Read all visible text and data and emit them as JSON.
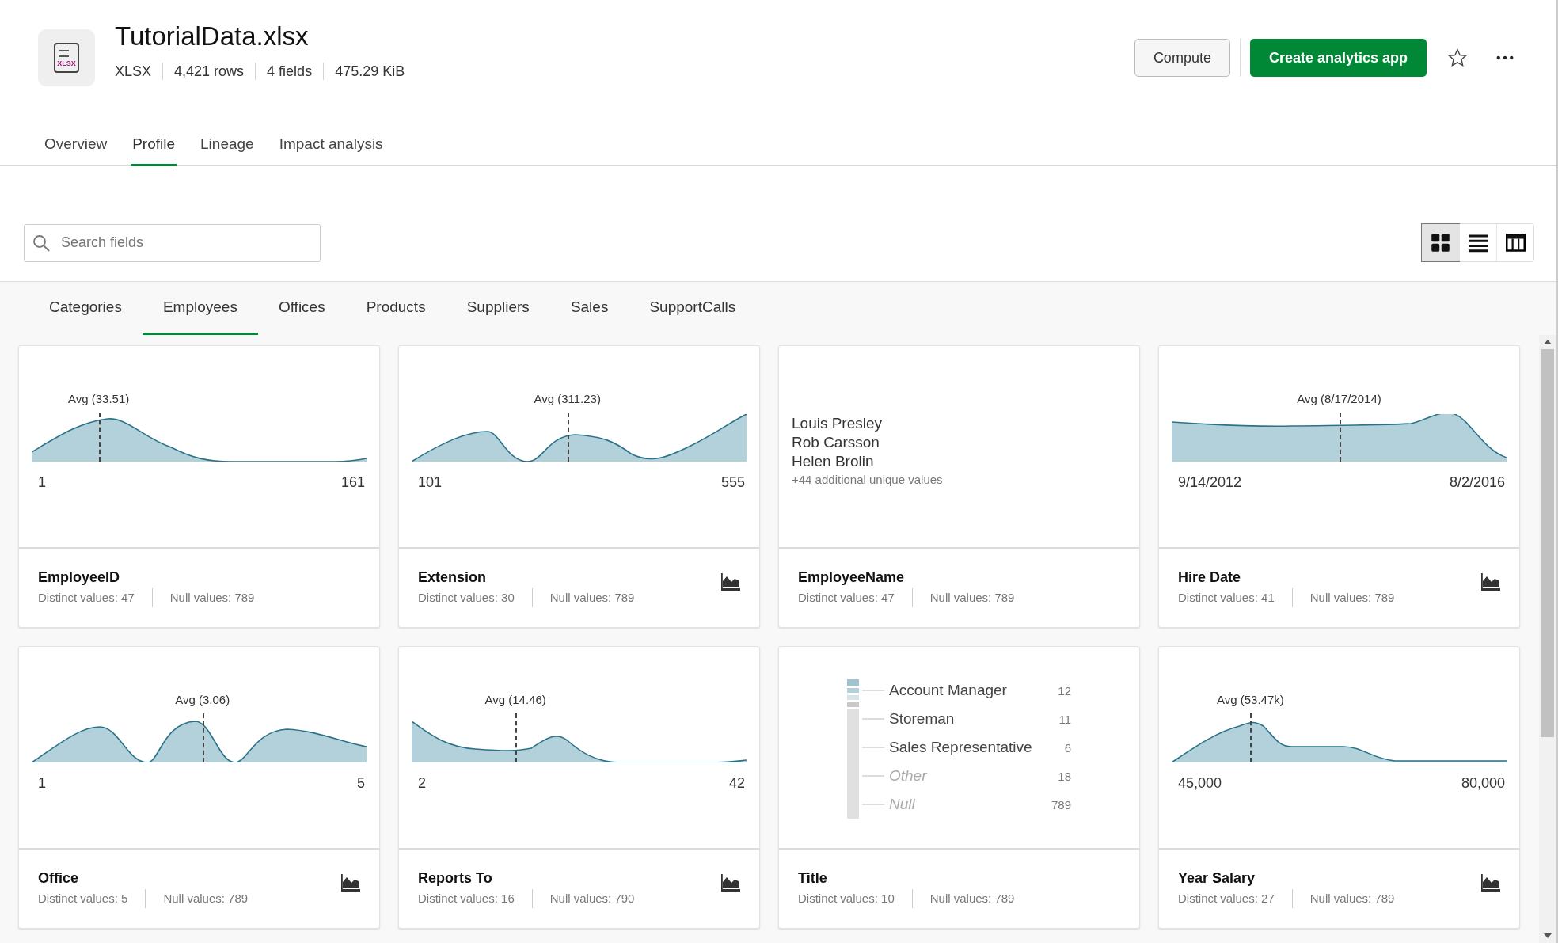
{
  "header": {
    "file_badge": "XLSX",
    "title": "TutorialData.xlsx",
    "meta": [
      "XLSX",
      "4,421 rows",
      "4 fields",
      "475.29 KiB"
    ],
    "buttons": {
      "compute": "Compute",
      "create": "Create analytics app"
    }
  },
  "tabs": [
    {
      "label": "Overview",
      "selected": false
    },
    {
      "label": "Profile",
      "selected": true
    },
    {
      "label": "Lineage",
      "selected": false
    },
    {
      "label": "Impact analysis",
      "selected": false
    }
  ],
  "search": {
    "placeholder": "Search fields"
  },
  "view_toggles": [
    {
      "kind": "grid",
      "selected": true
    },
    {
      "kind": "list",
      "selected": false
    },
    {
      "kind": "table",
      "selected": false
    }
  ],
  "table_tabs": [
    {
      "label": "Categories",
      "selected": false
    },
    {
      "label": "Employees",
      "selected": true
    },
    {
      "label": "Offices",
      "selected": false
    },
    {
      "label": "Products",
      "selected": false
    },
    {
      "label": "Suppliers",
      "selected": false
    },
    {
      "label": "Sales",
      "selected": false
    },
    {
      "label": "SupportCalls",
      "selected": false
    }
  ],
  "fields": [
    {
      "kind": "distribution",
      "name": "EmployeeID",
      "distinct": "Distinct values: 47",
      "nulls": "Null values: 789",
      "avg": "Avg (33.51)",
      "min": "1",
      "max": "161",
      "chart_icon": false
    },
    {
      "kind": "distribution",
      "name": "Extension",
      "distinct": "Distinct values: 30",
      "nulls": "Null values: 789",
      "avg": "Avg (311.23)",
      "min": "101",
      "max": "555",
      "chart_icon": true
    },
    {
      "kind": "values",
      "name": "EmployeeName",
      "distinct": "Distinct values: 47",
      "nulls": "Null values: 789",
      "values": [
        "Louis Presley",
        "Rob Carsson",
        "Helen Brolin"
      ],
      "more": "+44 additional unique values",
      "chart_icon": false
    },
    {
      "kind": "distribution",
      "name": "Hire Date",
      "distinct": "Distinct values: 41",
      "nulls": "Null values: 789",
      "avg": "Avg (8/17/2014)",
      "min": "9/14/2012",
      "max": "8/2/2016",
      "chart_icon": true
    },
    {
      "kind": "distribution",
      "name": "Office",
      "distinct": "Distinct values: 5",
      "nulls": "Null values: 789",
      "avg": "Avg (3.06)",
      "min": "1",
      "max": "5",
      "chart_icon": true
    },
    {
      "kind": "distribution",
      "name": "Reports To",
      "distinct": "Distinct values: 16",
      "nulls": "Null values: 790",
      "avg": "Avg (14.46)",
      "min": "2",
      "max": "42",
      "chart_icon": true
    },
    {
      "kind": "categories",
      "name": "Title",
      "distinct": "Distinct values: 10",
      "nulls": "Null values: 789",
      "chart_icon": false,
      "categories": [
        {
          "kind": "value",
          "label": "Account Manager",
          "count": "12"
        },
        {
          "kind": "value",
          "label": "Storeman",
          "count": "11"
        },
        {
          "kind": "value",
          "label": "Sales Representative",
          "count": "6"
        },
        {
          "kind": "other",
          "label": "Other",
          "count": "18"
        },
        {
          "kind": "null",
          "label": "Null",
          "count": "789"
        }
      ]
    },
    {
      "kind": "distribution",
      "name": "Year Salary",
      "distinct": "Distinct values: 27",
      "nulls": "Null values: 789",
      "avg": "Avg (53.47k)",
      "min": "45,000",
      "max": "80,000",
      "chart_icon": true
    }
  ]
}
